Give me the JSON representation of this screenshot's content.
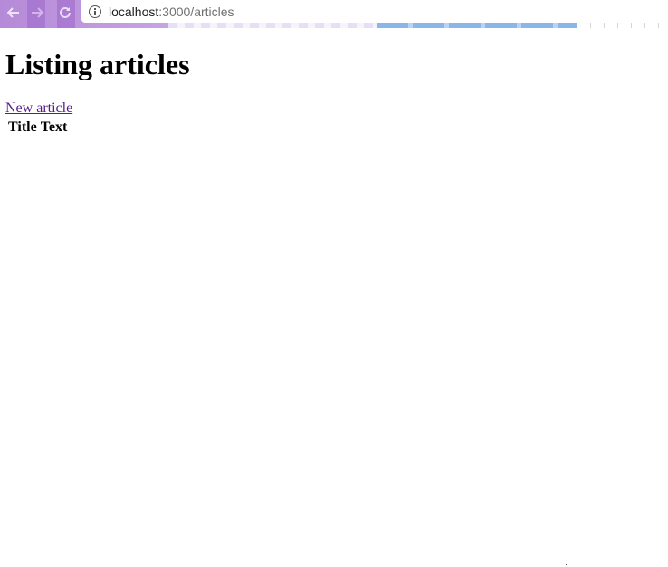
{
  "browser": {
    "url_host": "localhost",
    "url_path": ":3000/articles"
  },
  "page": {
    "title": "Listing articles",
    "new_article_link": "New article",
    "table": {
      "columns": [
        "Title",
        "Text"
      ],
      "rows": []
    }
  },
  "colors": {
    "visited_link": "#551a8b",
    "text": "#000000"
  },
  "icons": {
    "back": "back-arrow-icon",
    "forward": "forward-arrow-icon",
    "reload": "reload-icon",
    "site_info": "info-icon"
  }
}
